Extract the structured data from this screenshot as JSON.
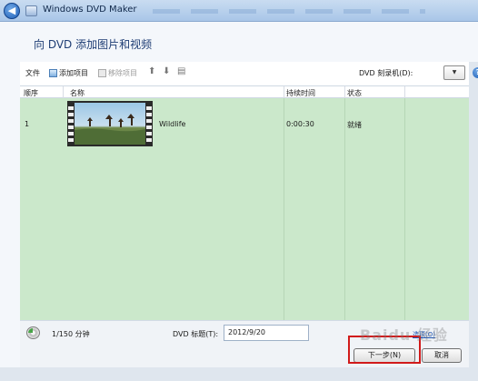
{
  "window": {
    "title": "Windows DVD Maker"
  },
  "header": {
    "title": "向 DVD 添加图片和视频"
  },
  "toolbar": {
    "file_label": "文件",
    "add_label": "添加项目",
    "remove_label": "移除项目",
    "drive_label": "DVD 刻录机(D):",
    "drive_value": "▼"
  },
  "list": {
    "columns": [
      "顺序",
      "名称",
      "持续时间",
      "状态"
    ],
    "rows": [
      {
        "order": "1",
        "name": "Wildlife",
        "duration": "0:00:30",
        "status": "就绪"
      }
    ]
  },
  "footer": {
    "capacity": "1/150 分钟",
    "dvd_title_label": "DVD 标题(T):",
    "dvd_title_value": "2012/9/20",
    "options_label": "选项(O)"
  },
  "buttons": {
    "next": "下一步(N)",
    "cancel": "取消"
  },
  "watermark": {
    "text": "Baidu 经验"
  },
  "colors": {
    "list_bg": "#cbe8cb",
    "highlight": "#d11a1a",
    "title_text": "#1e3d74"
  }
}
